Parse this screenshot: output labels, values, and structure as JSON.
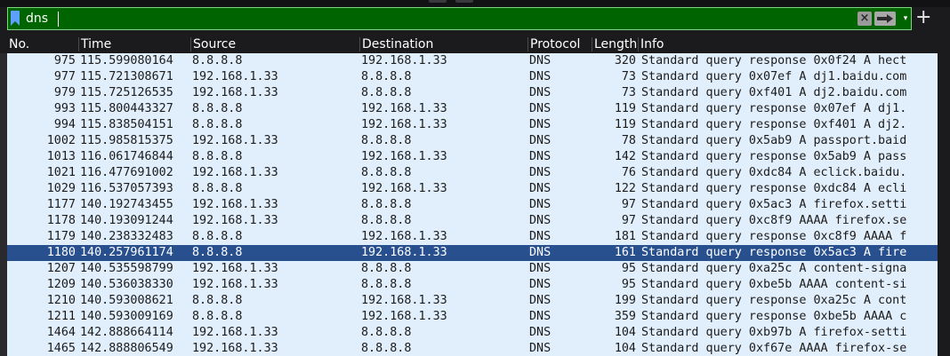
{
  "filter": {
    "value": "dns",
    "clear_icon": "×",
    "dropdown_icon": "▾",
    "add_icon": "+",
    "bg_color": "#006400"
  },
  "columns": {
    "no": "No.",
    "time": "Time",
    "source": "Source",
    "destination": "Destination",
    "protocol": "Protocol",
    "length": "Length",
    "info": "Info"
  },
  "colors": {
    "row_bg": "#e1eefb",
    "selected_bg": "#28508f"
  },
  "packets": [
    {
      "no": "975",
      "time": "115.599080164",
      "src": "8.8.8.8",
      "dst": "192.168.1.33",
      "proto": "DNS",
      "len": "320",
      "info": "Standard query response 0x0f24 A hect",
      "selected": false
    },
    {
      "no": "977",
      "time": "115.721308671",
      "src": "192.168.1.33",
      "dst": "8.8.8.8",
      "proto": "DNS",
      "len": "73",
      "info": "Standard query 0x07ef A dj1.baidu.com",
      "selected": false
    },
    {
      "no": "979",
      "time": "115.725126535",
      "src": "192.168.1.33",
      "dst": "8.8.8.8",
      "proto": "DNS",
      "len": "73",
      "info": "Standard query 0xf401 A dj2.baidu.com",
      "selected": false
    },
    {
      "no": "993",
      "time": "115.800443327",
      "src": "8.8.8.8",
      "dst": "192.168.1.33",
      "proto": "DNS",
      "len": "119",
      "info": "Standard query response 0x07ef A dj1.",
      "selected": false
    },
    {
      "no": "994",
      "time": "115.838504151",
      "src": "8.8.8.8",
      "dst": "192.168.1.33",
      "proto": "DNS",
      "len": "119",
      "info": "Standard query response 0xf401 A dj2.",
      "selected": false
    },
    {
      "no": "1002",
      "time": "115.985815375",
      "src": "192.168.1.33",
      "dst": "8.8.8.8",
      "proto": "DNS",
      "len": "78",
      "info": "Standard query 0x5ab9 A passport.baid",
      "selected": false
    },
    {
      "no": "1013",
      "time": "116.061746844",
      "src": "8.8.8.8",
      "dst": "192.168.1.33",
      "proto": "DNS",
      "len": "142",
      "info": "Standard query response 0x5ab9 A pass",
      "selected": false
    },
    {
      "no": "1021",
      "time": "116.477691002",
      "src": "192.168.1.33",
      "dst": "8.8.8.8",
      "proto": "DNS",
      "len": "76",
      "info": "Standard query 0xdc84 A eclick.baidu.",
      "selected": false
    },
    {
      "no": "1029",
      "time": "116.537057393",
      "src": "8.8.8.8",
      "dst": "192.168.1.33",
      "proto": "DNS",
      "len": "122",
      "info": "Standard query response 0xdc84 A ecli",
      "selected": false
    },
    {
      "no": "1177",
      "time": "140.192743455",
      "src": "192.168.1.33",
      "dst": "8.8.8.8",
      "proto": "DNS",
      "len": "97",
      "info": "Standard query 0x5ac3 A firefox.setti",
      "selected": false
    },
    {
      "no": "1178",
      "time": "140.193091244",
      "src": "192.168.1.33",
      "dst": "8.8.8.8",
      "proto": "DNS",
      "len": "97",
      "info": "Standard query 0xc8f9 AAAA firefox.se",
      "selected": false
    },
    {
      "no": "1179",
      "time": "140.238332483",
      "src": "8.8.8.8",
      "dst": "192.168.1.33",
      "proto": "DNS",
      "len": "181",
      "info": "Standard query response 0xc8f9 AAAA f",
      "selected": false
    },
    {
      "no": "1180",
      "time": "140.257961174",
      "src": "8.8.8.8",
      "dst": "192.168.1.33",
      "proto": "DNS",
      "len": "161",
      "info": "Standard query response 0x5ac3 A fire",
      "selected": true
    },
    {
      "no": "1207",
      "time": "140.535598799",
      "src": "192.168.1.33",
      "dst": "8.8.8.8",
      "proto": "DNS",
      "len": "95",
      "info": "Standard query 0xa25c A content-signa",
      "selected": false
    },
    {
      "no": "1209",
      "time": "140.536038330",
      "src": "192.168.1.33",
      "dst": "8.8.8.8",
      "proto": "DNS",
      "len": "95",
      "info": "Standard query 0xbe5b AAAA content-si",
      "selected": false
    },
    {
      "no": "1210",
      "time": "140.593008621",
      "src": "8.8.8.8",
      "dst": "192.168.1.33",
      "proto": "DNS",
      "len": "199",
      "info": "Standard query response 0xa25c A cont",
      "selected": false
    },
    {
      "no": "1211",
      "time": "140.593009169",
      "src": "8.8.8.8",
      "dst": "192.168.1.33",
      "proto": "DNS",
      "len": "359",
      "info": "Standard query response 0xbe5b AAAA c",
      "selected": false
    },
    {
      "no": "1464",
      "time": "142.888664114",
      "src": "192.168.1.33",
      "dst": "8.8.8.8",
      "proto": "DNS",
      "len": "104",
      "info": "Standard query 0xb97b A firefox-setti",
      "selected": false
    },
    {
      "no": "1465",
      "time": "142.888806549",
      "src": "192.168.1.33",
      "dst": "8.8.8.8",
      "proto": "DNS",
      "len": "104",
      "info": "Standard query 0xf67e AAAA firefox-se",
      "selected": false
    }
  ]
}
